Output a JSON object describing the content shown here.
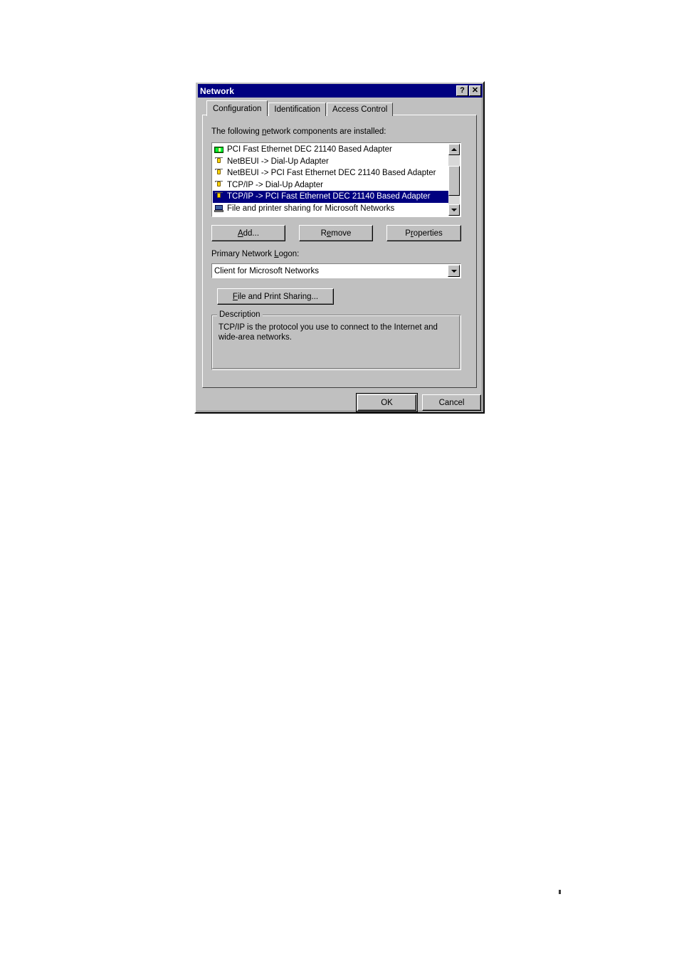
{
  "window": {
    "title": "Network",
    "help_button": "?",
    "close_button": "✕"
  },
  "tabs": [
    {
      "label": "Configuration",
      "selected": true
    },
    {
      "label": "Identification",
      "selected": false
    },
    {
      "label": "Access Control",
      "selected": false
    }
  ],
  "configuration": {
    "list_label_pre": "The following ",
    "list_label_mnemonic": "n",
    "list_label_post": "etwork components are installed:",
    "components": [
      {
        "label": "PCI Fast Ethernet DEC 21140 Based Adapter",
        "icon": "network-adapter-icon",
        "selected": false
      },
      {
        "label": "NetBEUI -> Dial-Up Adapter",
        "icon": "protocol-icon",
        "selected": false
      },
      {
        "label": "NetBEUI -> PCI Fast Ethernet DEC 21140 Based Adapter",
        "icon": "protocol-icon",
        "selected": false
      },
      {
        "label": "TCP/IP -> Dial-Up Adapter",
        "icon": "protocol-icon",
        "selected": false
      },
      {
        "label": "TCP/IP -> PCI Fast Ethernet DEC 21140 Based Adapter",
        "icon": "protocol-icon",
        "selected": true
      },
      {
        "label": "File and printer sharing for Microsoft Networks",
        "icon": "service-icon",
        "selected": false
      }
    ],
    "buttons": {
      "add": {
        "pre": "",
        "mnemonic": "A",
        "post": "dd..."
      },
      "remove": {
        "pre": "R",
        "mnemonic": "e",
        "post": "move"
      },
      "properties": {
        "pre": "P",
        "mnemonic": "r",
        "post": "operties"
      },
      "file_and_print_sharing": {
        "pre": "",
        "mnemonic": "F",
        "post": "ile and Print Sharing..."
      }
    },
    "primary_logon": {
      "label_pre": "Primary Network ",
      "label_mnemonic": "L",
      "label_post": "ogon:",
      "value": "Client for Microsoft Networks"
    },
    "description": {
      "title": "Description",
      "text": "TCP/IP is the protocol you use to connect to the Internet and wide-area networks."
    }
  },
  "footer": {
    "ok": "OK",
    "cancel": "Cancel"
  },
  "colors": {
    "titlebar": "#000080",
    "dialog_face": "#c0c0c0",
    "selection": "#000080",
    "selection_text": "#ffffff",
    "field_background": "#ffffff",
    "page_background": "#ffffff"
  }
}
